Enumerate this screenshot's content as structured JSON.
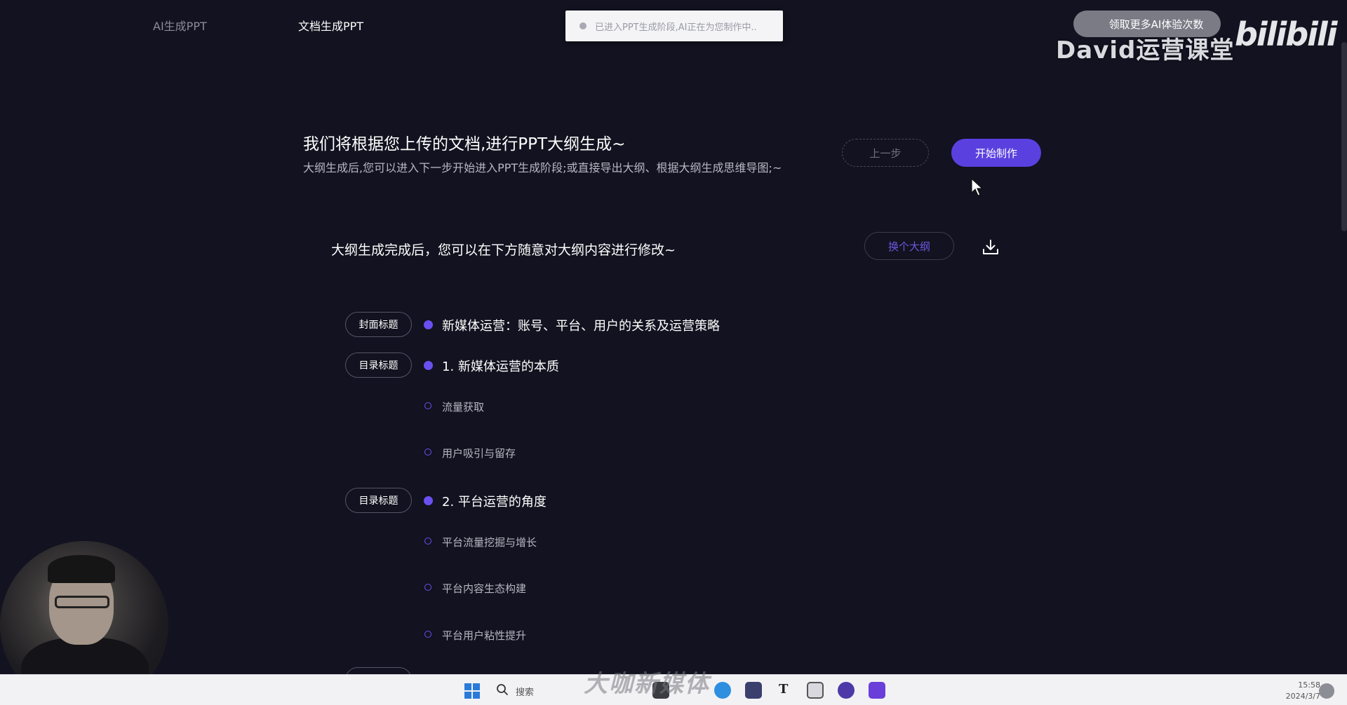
{
  "nav": {
    "tabs": [
      {
        "label": "AI生成PPT",
        "active": false
      },
      {
        "label": "文档生成PPT",
        "active": true
      }
    ]
  },
  "toast": {
    "message": "已进入PPT生成阶段,AI正在为您制作中.."
  },
  "overlay": {
    "promo_label": "领取更多AI体验次数",
    "watermark": "David运营课堂",
    "logo": "bilibili"
  },
  "header": {
    "title": "我们将根据您上传的文档,进行PPT大纲生成~",
    "subtitle": "大纲生成后,您可以进入下一步开始进入PPT生成阶段;或直接导出大纲、根据大纲生成思维导图;~",
    "prev_label": "上一步",
    "start_label": "开始制作"
  },
  "outline": {
    "hint": "大纲生成完成后，您可以在下方随意对大纲内容进行修改~",
    "switch_label": "换个大纲",
    "items": [
      {
        "tag": "封面标题",
        "text": "新媒体运营：账号、平台、用户的关系及运营策略",
        "level": "title"
      },
      {
        "tag": "目录标题",
        "text": "1. 新媒体运营的本质",
        "level": "title"
      },
      {
        "tag": "",
        "text": "流量获取",
        "level": "sub"
      },
      {
        "tag": "",
        "text": "用户吸引与留存",
        "level": "sub"
      },
      {
        "tag": "目录标题",
        "text": "2. 平台运营的角度",
        "level": "title"
      },
      {
        "tag": "",
        "text": "平台流量挖掘与增长",
        "level": "sub"
      },
      {
        "tag": "",
        "text": "平台内容生态构建",
        "level": "sub"
      },
      {
        "tag": "",
        "text": "平台用户粘性提升",
        "level": "sub"
      }
    ]
  },
  "taskbar": {
    "search_label": "搜索",
    "watermark": "大咖新媒体",
    "time": "15:58",
    "date": "2024/3/7"
  },
  "colors": {
    "background": "#121220",
    "accent": "#5b40e0",
    "outline_dot": "#6a50f0"
  }
}
